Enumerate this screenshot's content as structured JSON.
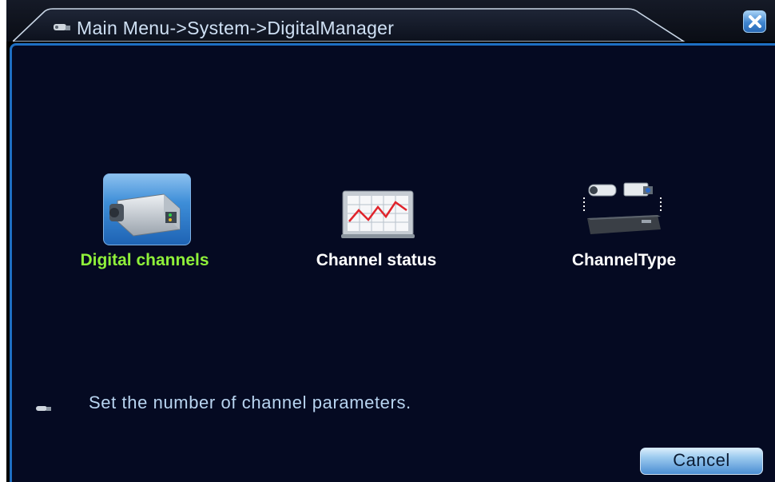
{
  "window": {
    "breadcrumb": "Main Menu->System->DigitalManager",
    "close_icon": "close-icon"
  },
  "menu_items": [
    {
      "label": "Digital channels",
      "icon": "ip-camera-icon",
      "selected": true
    },
    {
      "label": "Channel status",
      "icon": "line-chart-icon",
      "selected": false
    },
    {
      "label": "ChannelType",
      "icon": "camera-to-dvr-icon",
      "selected": false
    }
  ],
  "hint": {
    "text": "Set the number of channel parameters.",
    "icon": "camera-small-icon"
  },
  "buttons": {
    "cancel_label": "Cancel"
  },
  "colors": {
    "selected_label": "#8ff03a",
    "accent_border": "#1e6fc3",
    "panel_bg": "#050a22"
  }
}
